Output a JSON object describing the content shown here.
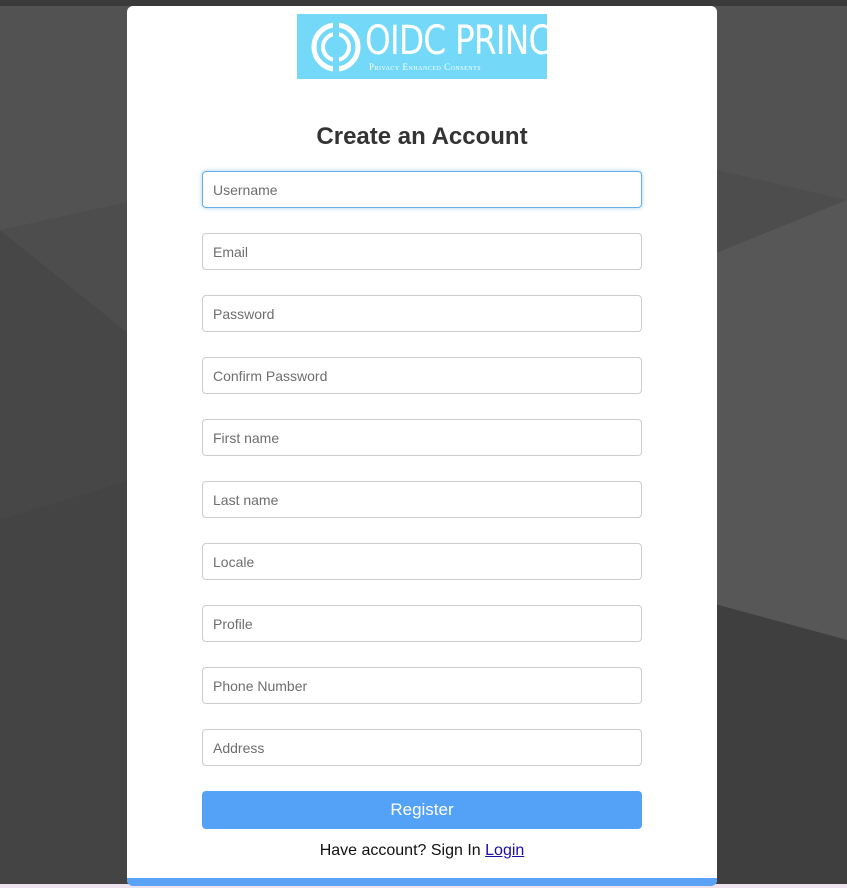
{
  "logo": {
    "title": "OIDC PRINCE",
    "subtitle": "Privacy Enhanced Consents",
    "bg_color": "#74d9f8"
  },
  "page_title": "Create an Account",
  "fields": {
    "username": {
      "placeholder": "Username",
      "value": ""
    },
    "email": {
      "placeholder": "Email",
      "value": ""
    },
    "password": {
      "placeholder": "Password",
      "value": ""
    },
    "confirm_password": {
      "placeholder": "Confirm Password",
      "value": ""
    },
    "first_name": {
      "placeholder": "First name",
      "value": ""
    },
    "last_name": {
      "placeholder": "Last name",
      "value": ""
    },
    "locale": {
      "placeholder": "Locale",
      "value": ""
    },
    "profile": {
      "placeholder": "Profile",
      "value": ""
    },
    "phone_number": {
      "placeholder": "Phone Number",
      "value": ""
    },
    "address": {
      "placeholder": "Address",
      "value": ""
    }
  },
  "register_label": "Register",
  "signin": {
    "prompt": "Have account? Sign In",
    "link_label": "Login"
  },
  "colors": {
    "accent": "#54a1f8",
    "background": "#4a4a4a",
    "card": "#ffffff"
  }
}
